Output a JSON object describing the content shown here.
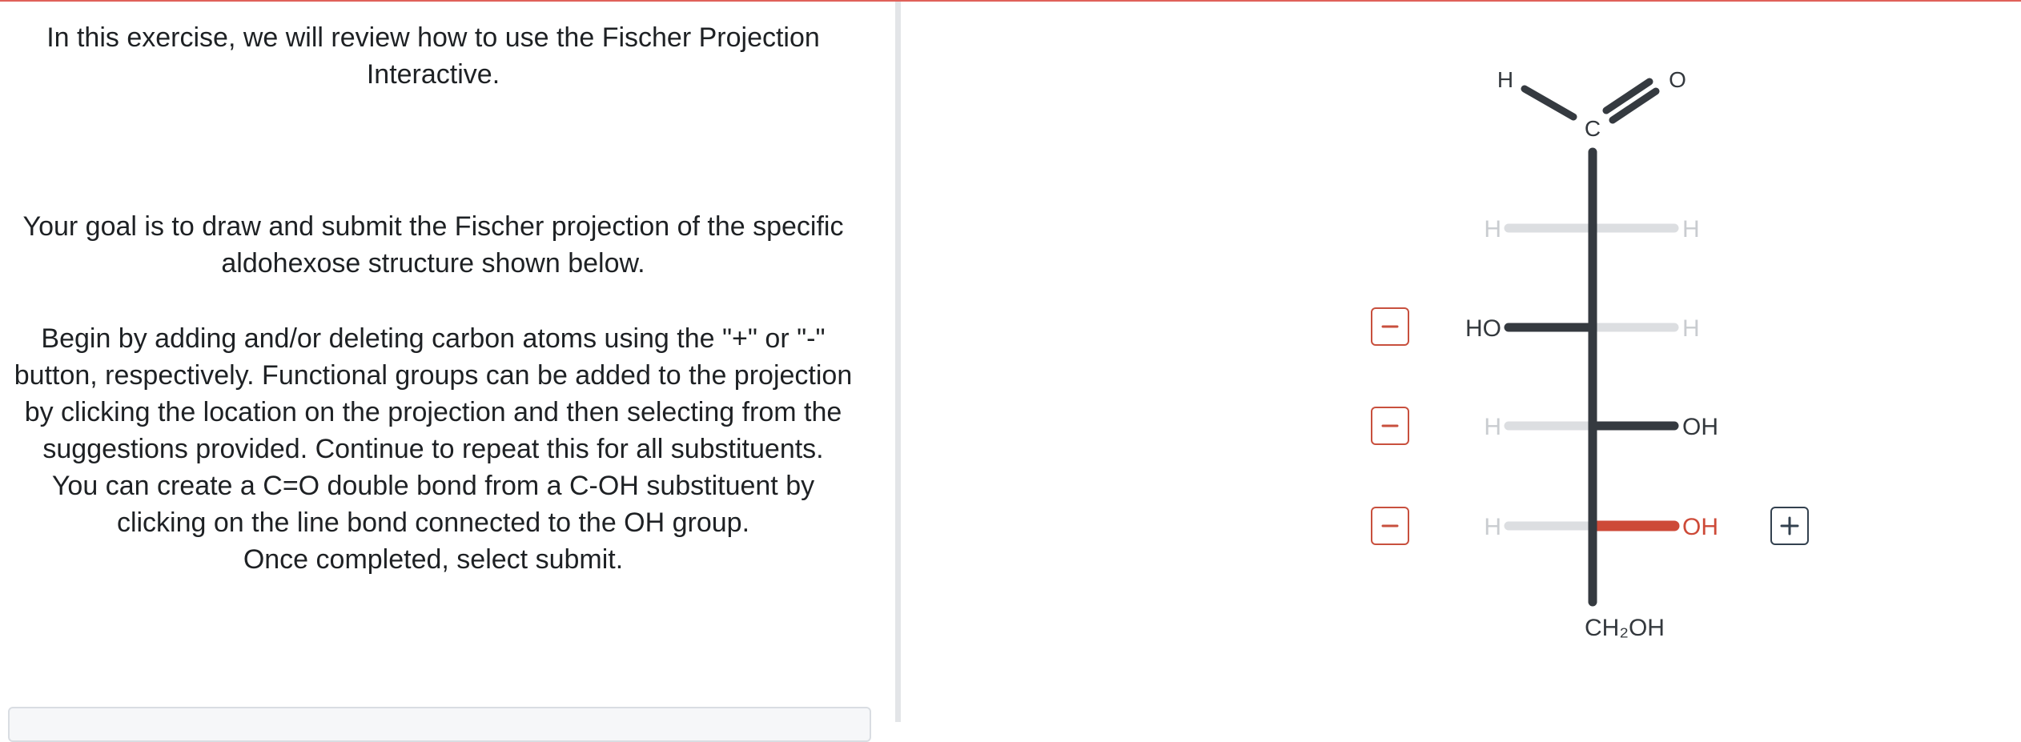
{
  "instructions": {
    "intro": "In this exercise, we will review how to use the Fischer Projection Interactive.",
    "goal": "Your goal is to draw and submit the Fischer projection of the specific aldohexose structure shown below.",
    "steps": [
      "Begin by adding and/or deleting carbon atoms using the \"+\" or \"-\" button, respectively. Functional groups can be added to the projection by clicking the location on the projection and then selecting from the suggestions provided. Continue to repeat this for all substituents.",
      "You can create a C=O double bond from a C-OH substituent by clicking on the line bond connected to the OH group.",
      "Once completed, select submit."
    ]
  },
  "molecule": {
    "aldehyde": {
      "hydrogen": "H",
      "carbon": "C",
      "oxygen": "O"
    },
    "rows": [
      {
        "left": "H",
        "right": "H",
        "left_state": "placeholder",
        "right_state": "placeholder"
      },
      {
        "left": "HO",
        "right": "H",
        "left_state": "set",
        "right_state": "placeholder"
      },
      {
        "left": "H",
        "right": "OH",
        "left_state": "placeholder",
        "right_state": "set"
      },
      {
        "left": "H",
        "right": "OH",
        "left_state": "placeholder",
        "right_state": "selected"
      }
    ],
    "bottom": "CH₂OH"
  },
  "controls": {
    "remove_symbol": "−",
    "add_symbol": "+"
  },
  "colors": {
    "bond_dark": "#353a40",
    "bond_light": "#dcdee1",
    "placeholder_text": "#c9ccd0",
    "selected": "#cd4a38",
    "add_button_border": "#33414f",
    "top_accent": "#e0615a"
  }
}
